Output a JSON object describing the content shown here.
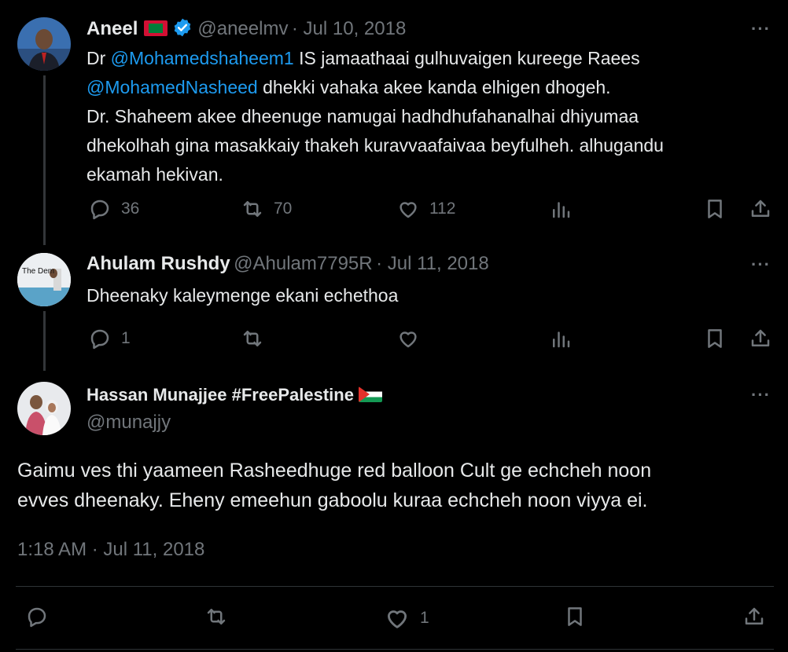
{
  "tweets": [
    {
      "name": "Aneel",
      "handle": "@aneelmv",
      "date": "· Jul 10, 2018",
      "text_parts": {
        "a": "Dr ",
        "mention1": "@Mohamedshaheem1",
        "b": " IS jamaathaai gulhuvaigen kureege Raees",
        "mention2": "@MohamedNasheed",
        "c": " dhekki vahaka akee kanda elhigen dhogeh.",
        "d": "Dr. Shaheem akee dheenuge namugai hadhdhufahanalhai dhiyumaa",
        "e": "dhekolhah gina masakkaiy thakeh kuravvaafaivaa beyfulheh. alhugandu",
        "f": "ekamah hekivan."
      },
      "replies": "36",
      "retweets": "70",
      "likes": "112"
    },
    {
      "name": "Ahulam Rushdy",
      "handle": "@Ahulam7795R",
      "date": "· Jul 11, 2018",
      "text": "Dheenaky kaleymenge ekani echethoa",
      "avatar_text": "The Dem",
      "replies": "1"
    }
  ],
  "main_tweet": {
    "name": "Hassan Munajjee #FreePalestine",
    "handle": "@munajjy",
    "text_line1": "Gaimu ves thi yaameen Rasheedhuge red balloon Cult ge echcheh noon",
    "text_line2": "evves dheenaky. Eheny emeehun gaboolu kuraa echcheh noon viyya ei.",
    "timestamp": "1:18 AM · Jul 11, 2018",
    "likes": "1"
  },
  "more_label": "···"
}
